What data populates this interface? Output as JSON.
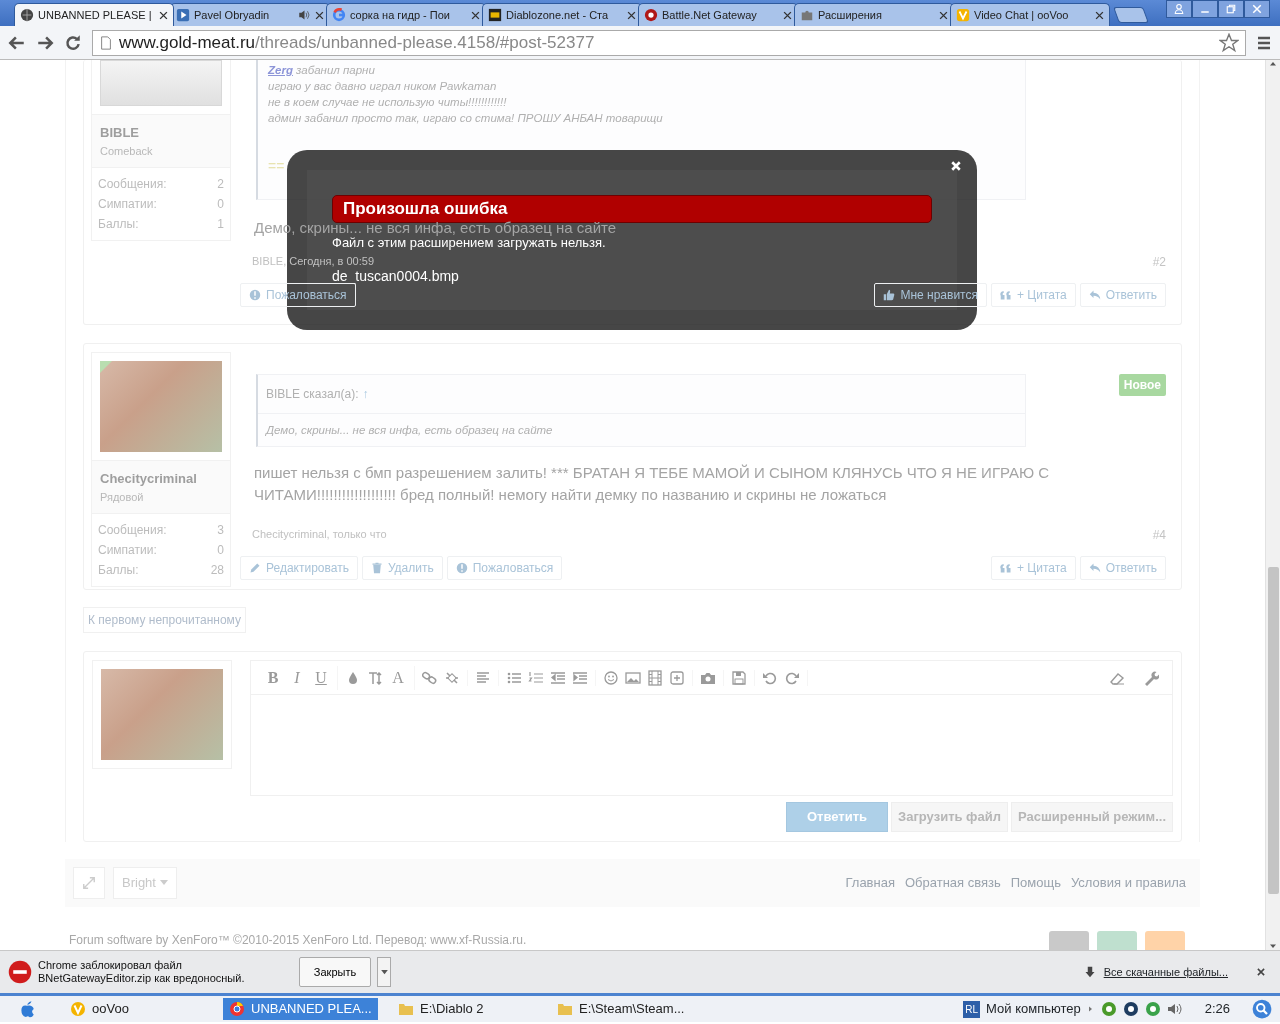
{
  "browser": {
    "tabs": [
      {
        "title": "UNBANNED PLEASE |",
        "selected": true,
        "audio": false
      },
      {
        "title": "Pavel Obryadin",
        "selected": false,
        "audio": true
      },
      {
        "title": "сорка на гидр - Пои",
        "selected": false,
        "audio": false
      },
      {
        "title": "Diablozone.net - Ста",
        "selected": false,
        "audio": false
      },
      {
        "title": "Battle.Net Gateway",
        "selected": false,
        "audio": false
      },
      {
        "title": "Расширения",
        "selected": false,
        "audio": false
      },
      {
        "title": "Video Chat | ooVoo",
        "selected": false,
        "audio": false
      }
    ],
    "address": {
      "host": "www.gold-meat.ru",
      "path": "/threads/unbanned-please.4158/#post-52377"
    }
  },
  "posts": [
    {
      "author": "BIBLE",
      "user_title": "Comeback",
      "stats": [
        {
          "label": "Сообщения:",
          "value": "2"
        },
        {
          "label": "Симпатии:",
          "value": "0"
        },
        {
          "label": "Баллы:",
          "value": "1"
        }
      ],
      "quote": {
        "lines": [
          {
            "link": "Zerg",
            "text": "забанил парни"
          },
          {
            "text": "играю у вас давно играл ником Pawkaman"
          },
          {
            "text": "не в коем случае не использую читы!!!!!!!!!!!!"
          },
          {
            "text": "админ забанил просто так, играю со стима! ПРОШУ АНБАН товарищи"
          }
        ],
        "mark": "=="
      },
      "message": "Демо, скрины... не вся инфа, есть образец на сайте",
      "meta": "BIBLE, Сегодня, в 00:59",
      "number": "#2",
      "left_buttons": [
        {
          "label": "Пожаловаться",
          "kind": "report"
        }
      ],
      "right_buttons": [
        {
          "label": "Мне нравится",
          "kind": "like"
        },
        {
          "label": "+ Цитата",
          "kind": "quote"
        },
        {
          "label": "Ответить",
          "kind": "reply"
        }
      ]
    },
    {
      "author": "Checitycriminal",
      "user_title": "Рядовой",
      "online": true,
      "stats": [
        {
          "label": "Сообщения:",
          "value": "3"
        },
        {
          "label": "Симпатии:",
          "value": "0"
        },
        {
          "label": "Баллы:",
          "value": "28"
        }
      ],
      "quote": {
        "header": "BIBLE сказал(а):",
        "jump": "↑",
        "lines": [
          {
            "text": "Демо, скрины... не вся инфа, есть образец на сайте"
          }
        ]
      },
      "badge": "Новое",
      "message": "пишет нельзя с бмп разрешением залить! *** БРАТАН Я ТЕБЕ МАМОЙ И СЫНОМ КЛЯНУСЬ ЧТО Я НЕ ИГРАЮ С ЧИТАМИ!!!!!!!!!!!!!!!!!!! бред полный! немогу найти демку по названию и скрины не ложаться",
      "meta": "Checitycriminal, только что",
      "number": "#4",
      "left_buttons": [
        {
          "label": "Редактировать",
          "kind": "edit"
        },
        {
          "label": "Удалить",
          "kind": "delete"
        },
        {
          "label": "Пожаловаться",
          "kind": "report"
        }
      ],
      "right_buttons": [
        {
          "label": "+ Цитата",
          "kind": "quote"
        },
        {
          "label": "Ответить",
          "kind": "reply"
        }
      ]
    }
  ],
  "jump_link": "К первому непрочитанному",
  "editor": {
    "glyphs": [
      "B",
      "I",
      "U",
      "A"
    ],
    "buttons": [
      {
        "label": "Ответить",
        "kind": "primary"
      },
      {
        "label": "Загрузить файл",
        "kind": "secondary"
      },
      {
        "label": "Расширенный режим...",
        "kind": "secondary"
      }
    ]
  },
  "footer": {
    "style_chooser": "Bright",
    "links": [
      "Главная",
      "Обратная связь",
      "Помощь",
      "Условия и правила"
    ],
    "copyright": "Forum software by XenForo™ ©2010-2015 XenForo Ltd. Перевод: www.xf-Russia.ru."
  },
  "dialog": {
    "title": "Произошла ошибка",
    "message": "Файл с этим расширением загружать нельзя.",
    "file": "de_tuscan0004.bmp"
  },
  "download_bar": {
    "lines": [
      "Chrome заблокировал файл",
      "BNetGatewayEditor.zip как вредоносный."
    ],
    "close_button": "Закрыть",
    "all_downloads": "Все скачанные файлы..."
  },
  "taskbar": {
    "items": [
      {
        "label": "ooVoo",
        "selected": false,
        "kind": "app"
      },
      {
        "label": "UNBANNED PLEA...",
        "selected": true,
        "kind": "browser"
      },
      {
        "label": "E:\\Diablo 2",
        "selected": false,
        "kind": "folder"
      },
      {
        "label": "E:\\Steam\\Steam...",
        "selected": false,
        "kind": "folder"
      }
    ],
    "tray_badge": "RL",
    "computer": "Мой компьютер",
    "clock": "2:26"
  }
}
